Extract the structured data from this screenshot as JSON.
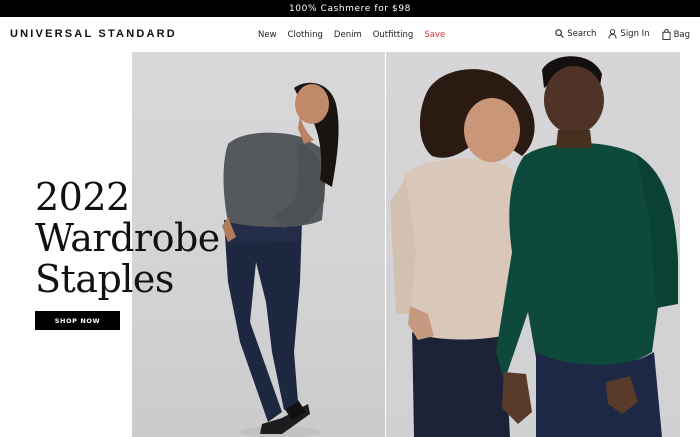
{
  "promo": {
    "text": "100% Cashmere for $98"
  },
  "brand": {
    "logo": "UNIVERSAL STANDARD"
  },
  "nav": {
    "items": [
      {
        "label": "New"
      },
      {
        "label": "Clothing"
      },
      {
        "label": "Denim"
      },
      {
        "label": "Outfitting"
      },
      {
        "label": "Save"
      }
    ]
  },
  "utility": {
    "search": "Search",
    "sign_in": "Sign In",
    "bag": "Bag"
  },
  "hero": {
    "headline": [
      "2022",
      "Wardrobe",
      "Staples"
    ],
    "cta": "SHOP NOW"
  },
  "colors": {
    "promo_bg": "#000000",
    "sale_red": "#e0332f",
    "photo_bg": "#d5d5d7",
    "sweater_grey": "#55585c",
    "sweater_beige": "#d9c8ba",
    "sweater_green": "#0e4a3c",
    "denim": "#1e2740"
  },
  "icons": [
    "search-icon",
    "user-icon",
    "bag-icon"
  ]
}
